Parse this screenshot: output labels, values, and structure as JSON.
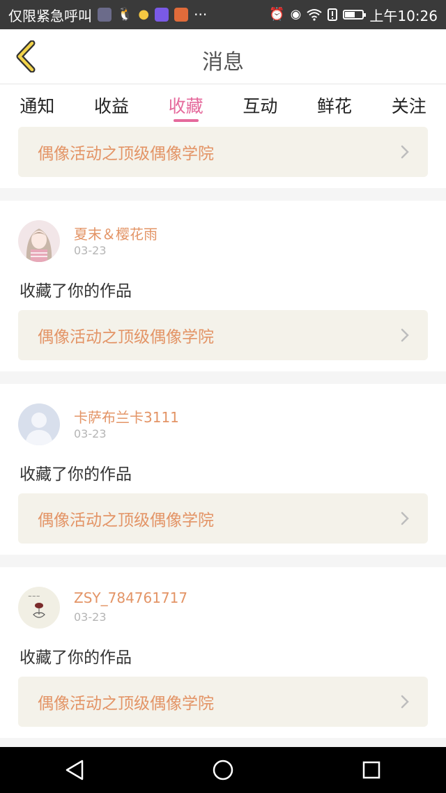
{
  "status_bar": {
    "carrier": "仅限紧急呼叫",
    "more": "···",
    "time": "上午10:26",
    "battery_level": 0.6
  },
  "header": {
    "title": "消息",
    "back_icon": "chevron-left-icon"
  },
  "tabs": [
    {
      "label": "通知",
      "active": false
    },
    {
      "label": "收益",
      "active": false
    },
    {
      "label": "收藏",
      "active": true
    },
    {
      "label": "互动",
      "active": false
    },
    {
      "label": "鲜花",
      "active": false
    },
    {
      "label": "关注",
      "active": false
    }
  ],
  "feed": {
    "first_card": {
      "work_title": "偶像活动之顶级偶像学院"
    },
    "items": [
      {
        "username": "夏末＆樱花雨",
        "date": "03-23",
        "action": "收藏了你的作品",
        "work_title": "偶像活动之顶级偶像学院",
        "avatar": "anime-girl-avatar"
      },
      {
        "username": "卡萨布兰卡3111",
        "date": "03-23",
        "action": "收藏了你的作品",
        "work_title": "偶像活动之顶级偶像学院",
        "avatar": "default-user-avatar"
      },
      {
        "username": "ZSY_784761717",
        "date": "03-23",
        "action": "收藏了你的作品",
        "work_title": "偶像活动之顶级偶像学院",
        "avatar": "sketch-avatar"
      }
    ]
  },
  "colors": {
    "accent_pink": "#e56a9c",
    "orange_text": "#e39466",
    "work_box_bg": "#f4f2ea"
  }
}
